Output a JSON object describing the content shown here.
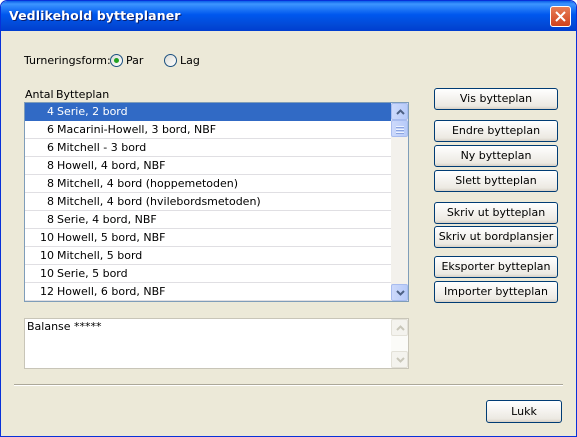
{
  "window": {
    "title": "Vedlikehold bytteplaner",
    "close_label": "close"
  },
  "tournament": {
    "label": "Turneringsform:",
    "options": [
      {
        "label": "Par",
        "selected": true
      },
      {
        "label": "Lag",
        "selected": false
      }
    ]
  },
  "table": {
    "headers": {
      "count": "Antal",
      "plan": "Bytteplan"
    },
    "rows": [
      {
        "count": "4",
        "plan": "Serie, 2 bord",
        "selected": true
      },
      {
        "count": "6",
        "plan": "Macarini-Howell, 3 bord, NBF"
      },
      {
        "count": "6",
        "plan": "Mitchell - 3 bord"
      },
      {
        "count": "8",
        "plan": "Howell, 4 bord, NBF"
      },
      {
        "count": "8",
        "plan": "Mitchell, 4 bord (hoppemetoden)"
      },
      {
        "count": "8",
        "plan": "Mitchell, 4 bord (hvilebordsmetoden)"
      },
      {
        "count": "8",
        "plan": "Serie, 4 bord, NBF"
      },
      {
        "count": "10",
        "plan": "Howell, 5 bord, NBF"
      },
      {
        "count": "10",
        "plan": "Mitchell, 5 bord"
      },
      {
        "count": "10",
        "plan": "Serie, 5 bord"
      },
      {
        "count": "12",
        "plan": "Howell, 6 bord, NBF"
      }
    ]
  },
  "memo": {
    "text": "Balanse *****"
  },
  "buttons": {
    "vis": "Vis bytteplan",
    "endre": "Endre bytteplan",
    "ny": "Ny bytteplan",
    "slett": "Slett bytteplan",
    "skriv_ut": "Skriv ut bytteplan",
    "skriv_bordplansjer": "Skriv ut bordplansjer",
    "eksporter": "Eksporter bytteplan",
    "importer": "Importer bytteplan",
    "lukk": "Lukk"
  },
  "colors": {
    "titlebar": "#0058ee",
    "selection": "#316ac5",
    "radio_dot": "#21a121",
    "close_button": "#d1421c"
  }
}
